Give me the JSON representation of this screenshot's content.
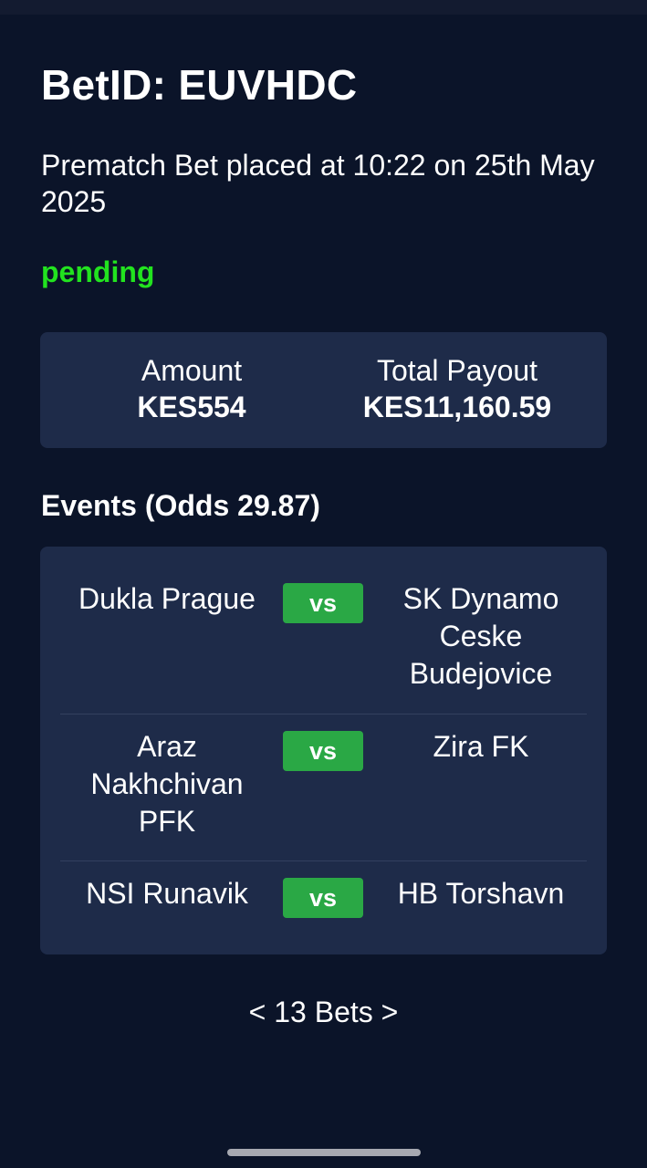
{
  "bet": {
    "title": "BetID: EUVHDC",
    "placed_text": "Prematch Bet placed at 10:22 on 25th May 2025",
    "status": "pending",
    "status_color": "#22e31f"
  },
  "summary": {
    "amount_label": "Amount",
    "amount_value": "KES554",
    "payout_label": "Total Payout",
    "payout_value": "KES11,160.59"
  },
  "events": {
    "heading": "Events (Odds 29.87)",
    "vs_label": "vs",
    "items": [
      {
        "home": "Dukla Prague",
        "away": "SK Dynamo Ceske Budejovice"
      },
      {
        "home": "Araz Nakhchivan PFK",
        "away": "Zira FK"
      },
      {
        "home": "NSI Runavik",
        "away": "HB Torshavn"
      }
    ]
  },
  "pager": {
    "text": "< 13 Bets >"
  }
}
